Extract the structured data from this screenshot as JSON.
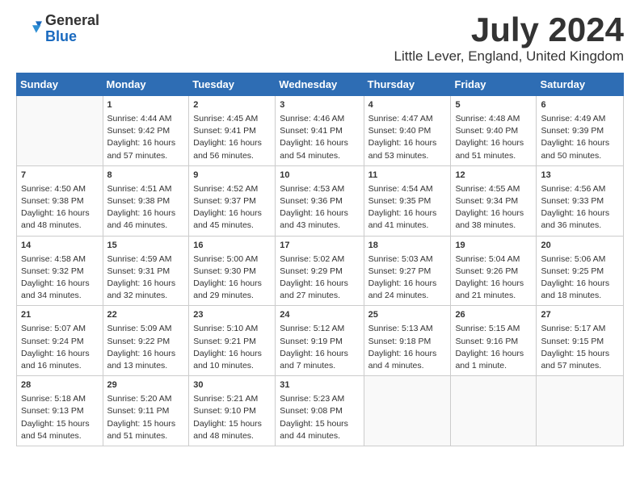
{
  "logo": {
    "general": "General",
    "blue": "Blue"
  },
  "header": {
    "month": "July 2024",
    "location": "Little Lever, England, United Kingdom"
  },
  "weekdays": [
    "Sunday",
    "Monday",
    "Tuesday",
    "Wednesday",
    "Thursday",
    "Friday",
    "Saturday"
  ],
  "weeks": [
    [
      {
        "day": "",
        "content": ""
      },
      {
        "day": "1",
        "content": "Sunrise: 4:44 AM\nSunset: 9:42 PM\nDaylight: 16 hours\nand 57 minutes."
      },
      {
        "day": "2",
        "content": "Sunrise: 4:45 AM\nSunset: 9:41 PM\nDaylight: 16 hours\nand 56 minutes."
      },
      {
        "day": "3",
        "content": "Sunrise: 4:46 AM\nSunset: 9:41 PM\nDaylight: 16 hours\nand 54 minutes."
      },
      {
        "day": "4",
        "content": "Sunrise: 4:47 AM\nSunset: 9:40 PM\nDaylight: 16 hours\nand 53 minutes."
      },
      {
        "day": "5",
        "content": "Sunrise: 4:48 AM\nSunset: 9:40 PM\nDaylight: 16 hours\nand 51 minutes."
      },
      {
        "day": "6",
        "content": "Sunrise: 4:49 AM\nSunset: 9:39 PM\nDaylight: 16 hours\nand 50 minutes."
      }
    ],
    [
      {
        "day": "7",
        "content": "Sunrise: 4:50 AM\nSunset: 9:38 PM\nDaylight: 16 hours\nand 48 minutes."
      },
      {
        "day": "8",
        "content": "Sunrise: 4:51 AM\nSunset: 9:38 PM\nDaylight: 16 hours\nand 46 minutes."
      },
      {
        "day": "9",
        "content": "Sunrise: 4:52 AM\nSunset: 9:37 PM\nDaylight: 16 hours\nand 45 minutes."
      },
      {
        "day": "10",
        "content": "Sunrise: 4:53 AM\nSunset: 9:36 PM\nDaylight: 16 hours\nand 43 minutes."
      },
      {
        "day": "11",
        "content": "Sunrise: 4:54 AM\nSunset: 9:35 PM\nDaylight: 16 hours\nand 41 minutes."
      },
      {
        "day": "12",
        "content": "Sunrise: 4:55 AM\nSunset: 9:34 PM\nDaylight: 16 hours\nand 38 minutes."
      },
      {
        "day": "13",
        "content": "Sunrise: 4:56 AM\nSunset: 9:33 PM\nDaylight: 16 hours\nand 36 minutes."
      }
    ],
    [
      {
        "day": "14",
        "content": "Sunrise: 4:58 AM\nSunset: 9:32 PM\nDaylight: 16 hours\nand 34 minutes."
      },
      {
        "day": "15",
        "content": "Sunrise: 4:59 AM\nSunset: 9:31 PM\nDaylight: 16 hours\nand 32 minutes."
      },
      {
        "day": "16",
        "content": "Sunrise: 5:00 AM\nSunset: 9:30 PM\nDaylight: 16 hours\nand 29 minutes."
      },
      {
        "day": "17",
        "content": "Sunrise: 5:02 AM\nSunset: 9:29 PM\nDaylight: 16 hours\nand 27 minutes."
      },
      {
        "day": "18",
        "content": "Sunrise: 5:03 AM\nSunset: 9:27 PM\nDaylight: 16 hours\nand 24 minutes."
      },
      {
        "day": "19",
        "content": "Sunrise: 5:04 AM\nSunset: 9:26 PM\nDaylight: 16 hours\nand 21 minutes."
      },
      {
        "day": "20",
        "content": "Sunrise: 5:06 AM\nSunset: 9:25 PM\nDaylight: 16 hours\nand 18 minutes."
      }
    ],
    [
      {
        "day": "21",
        "content": "Sunrise: 5:07 AM\nSunset: 9:24 PM\nDaylight: 16 hours\nand 16 minutes."
      },
      {
        "day": "22",
        "content": "Sunrise: 5:09 AM\nSunset: 9:22 PM\nDaylight: 16 hours\nand 13 minutes."
      },
      {
        "day": "23",
        "content": "Sunrise: 5:10 AM\nSunset: 9:21 PM\nDaylight: 16 hours\nand 10 minutes."
      },
      {
        "day": "24",
        "content": "Sunrise: 5:12 AM\nSunset: 9:19 PM\nDaylight: 16 hours\nand 7 minutes."
      },
      {
        "day": "25",
        "content": "Sunrise: 5:13 AM\nSunset: 9:18 PM\nDaylight: 16 hours\nand 4 minutes."
      },
      {
        "day": "26",
        "content": "Sunrise: 5:15 AM\nSunset: 9:16 PM\nDaylight: 16 hours\nand 1 minute."
      },
      {
        "day": "27",
        "content": "Sunrise: 5:17 AM\nSunset: 9:15 PM\nDaylight: 15 hours\nand 57 minutes."
      }
    ],
    [
      {
        "day": "28",
        "content": "Sunrise: 5:18 AM\nSunset: 9:13 PM\nDaylight: 15 hours\nand 54 minutes."
      },
      {
        "day": "29",
        "content": "Sunrise: 5:20 AM\nSunset: 9:11 PM\nDaylight: 15 hours\nand 51 minutes."
      },
      {
        "day": "30",
        "content": "Sunrise: 5:21 AM\nSunset: 9:10 PM\nDaylight: 15 hours\nand 48 minutes."
      },
      {
        "day": "31",
        "content": "Sunrise: 5:23 AM\nSunset: 9:08 PM\nDaylight: 15 hours\nand 44 minutes."
      },
      {
        "day": "",
        "content": ""
      },
      {
        "day": "",
        "content": ""
      },
      {
        "day": "",
        "content": ""
      }
    ]
  ]
}
